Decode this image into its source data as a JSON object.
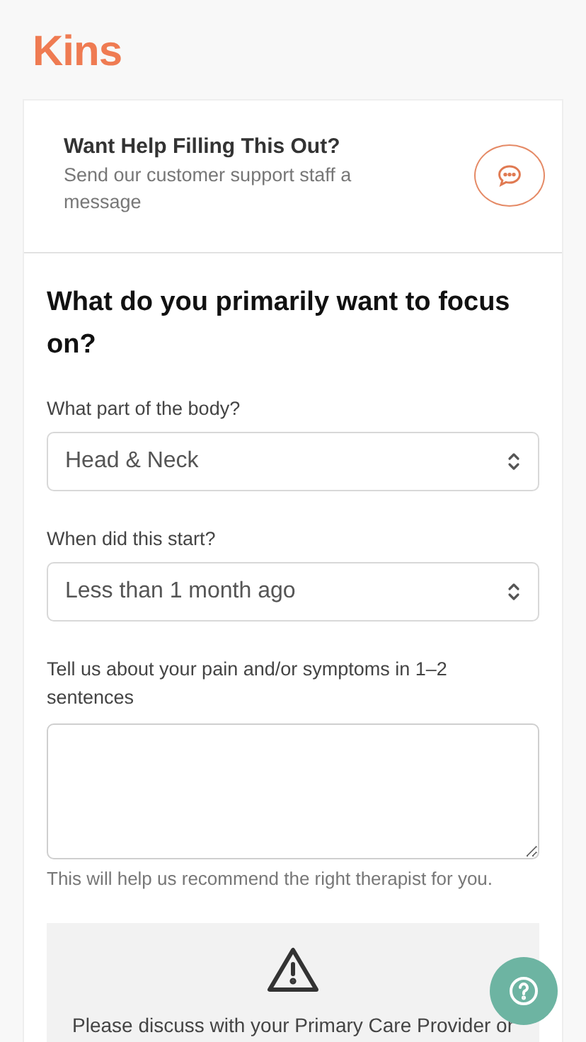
{
  "logo": "Kins",
  "help": {
    "title": "Want Help Filling This Out?",
    "subtitle": "Send our customer support staff a message"
  },
  "form": {
    "title": "What do you primarily want to focus on?",
    "fields": [
      {
        "kind": "select",
        "label": "What part of the body?",
        "value": "Head & Neck"
      },
      {
        "kind": "select",
        "label": "When did this start?",
        "value": "Less than 1 month ago"
      },
      {
        "kind": "textarea",
        "label": "Tell us about your pain and/or symptoms in 1–2 sentences",
        "hint": "This will help us recommend the right therapist for you."
      }
    ]
  },
  "warning": {
    "text": "Please discuss with your Primary Care Provider or"
  }
}
